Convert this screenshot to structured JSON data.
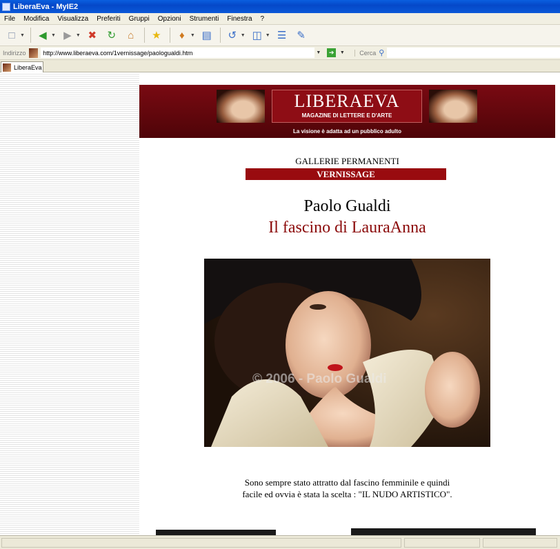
{
  "window": {
    "title": "LiberaEva - MyIE2"
  },
  "menu": [
    "File",
    "Modifica",
    "Visualizza",
    "Preferiti",
    "Gruppi",
    "Opzioni",
    "Strumenti",
    "Finestra",
    "?"
  ],
  "address": {
    "label": "Indirizzo",
    "url": "http://www.liberaeva.com/1vernissage/paologualdi.htm",
    "search_label": "Cerca"
  },
  "tab": {
    "label": "LiberaEva"
  },
  "page": {
    "banner": {
      "title": "LIBERAEVA",
      "subtitle": "MAGAZINE DI LETTERE E D'ARTE",
      "note": "La visione è adatta ad un pubblico adulto"
    },
    "section": "GALLERIE PERMANENTI",
    "category": "VERNISSAGE",
    "artist": "Paolo Gualdi",
    "work_title": "Il fascino di LauraAnna",
    "watermark": "© 2006 - Paolo Gualdi",
    "caption_line1": "Sono sempre stato attratto dal fascino femminile  e quindi",
    "caption_line2": "facile ed ovvia è stata la scelta : \"IL NUDO ARTISTICO\"."
  },
  "colors": {
    "banner_red": "#8e0d15",
    "title_red": "#8b0a0a",
    "xp_blue": "#0548c8"
  }
}
